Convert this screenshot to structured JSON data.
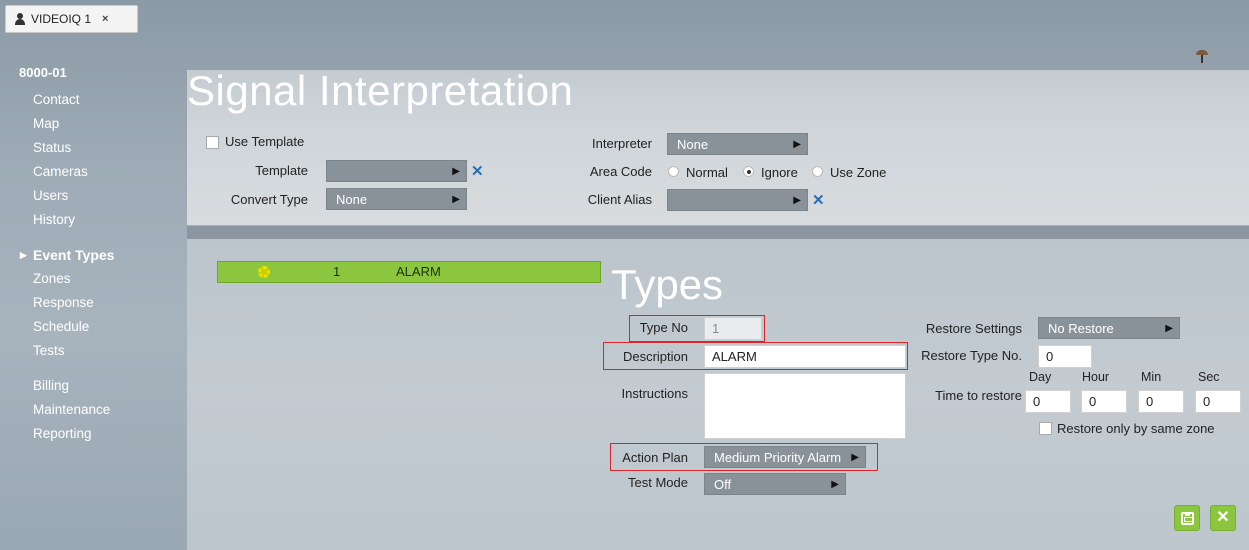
{
  "tab": {
    "label": "VIDEOIQ 1",
    "close": "×",
    "icon": "user-group-icon"
  },
  "sidebar": {
    "account": "8000-01",
    "group1": [
      "Contact",
      "Map",
      "Status",
      "Cameras",
      "Users",
      "History"
    ],
    "group2": [
      "Event Types",
      "Zones",
      "Response",
      "Schedule",
      "Tests"
    ],
    "group3": [
      "Billing",
      "Maintenance",
      "Reporting"
    ],
    "active": "Event Types"
  },
  "signal": {
    "title": "Signal Interpretation",
    "use_template_label": "Use Template",
    "use_template_checked": false,
    "template_label": "Template",
    "template_value": "",
    "convert_type_label": "Convert Type",
    "convert_type_value": "None",
    "interpreter_label": "Interpreter",
    "interpreter_value": "None",
    "area_code_label": "Area Code",
    "area_code_options": [
      "Normal",
      "Ignore",
      "Use Zone"
    ],
    "area_code_selected": "Ignore",
    "client_alias_label": "Client Alias",
    "client_alias_value": ""
  },
  "event_list": [
    {
      "no": "1",
      "name": "ALARM",
      "icon": "gear-icon"
    }
  ],
  "types": {
    "title": "Types",
    "type_no_label": "Type No",
    "type_no_value": "1",
    "description_label": "Description",
    "description_value": "ALARM",
    "instructions_label": "Instructions",
    "instructions_value": "",
    "action_plan_label": "Action Plan",
    "action_plan_value": "Medium Priority Alarm",
    "test_mode_label": "Test Mode",
    "test_mode_value": "Off",
    "restore_settings_label": "Restore Settings",
    "restore_settings_value": "No Restore",
    "restore_type_label": "Restore Type No.",
    "restore_type_value": "0",
    "time_to_restore_label": "Time to restore",
    "time_units": [
      "Day",
      "Hour",
      "Min",
      "Sec"
    ],
    "time_values": [
      "0",
      "0",
      "0",
      "0"
    ],
    "restore_same_zone_label": "Restore only by same zone",
    "restore_same_zone_checked": false
  },
  "colors": {
    "accent": "#8cc53e",
    "highlight": "#d9262c",
    "clear": "#2b6db3"
  }
}
